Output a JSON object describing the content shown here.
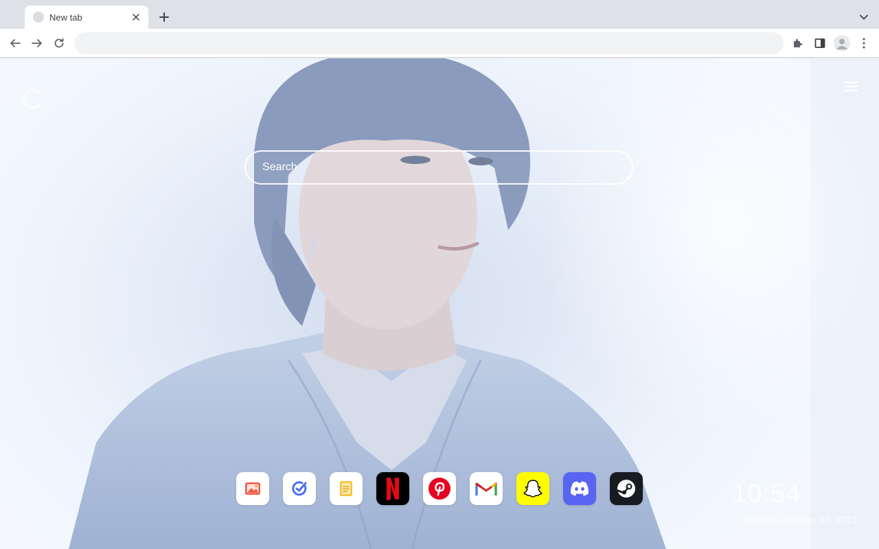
{
  "browser": {
    "tab": {
      "title": "New tab",
      "favicon": "globe-icon"
    },
    "icons": {
      "tab_close": "close-icon",
      "new_tab": "plus-icon",
      "tab_search": "chevron-down-icon",
      "back": "back-arrow-icon",
      "forward": "forward-arrow-icon",
      "reload": "reload-icon",
      "extensions": "puzzle-icon",
      "side_panel": "side-panel-icon",
      "profile": "avatar-icon",
      "menu": "kebab-menu-icon"
    },
    "omnibox": {
      "value": "",
      "placeholder": ""
    }
  },
  "newtab": {
    "search": {
      "placeholder": "Search"
    },
    "menu_icon": "hamburger-icon",
    "logo_icon": "brand-logo-icon",
    "shortcuts": [
      {
        "name": "photos",
        "icon": "photo-icon",
        "bg": "#ffffff"
      },
      {
        "name": "tasks",
        "icon": "check-circle-icon",
        "bg": "#ffffff"
      },
      {
        "name": "notes",
        "icon": "notes-icon",
        "bg": "#ffffff"
      },
      {
        "name": "netflix",
        "icon": "netflix-icon",
        "bg": "#000000"
      },
      {
        "name": "pinterest",
        "icon": "pinterest-icon",
        "bg": "#ffffff"
      },
      {
        "name": "gmail",
        "icon": "gmail-icon",
        "bg": "#ffffff"
      },
      {
        "name": "snapchat",
        "icon": "snapchat-icon",
        "bg": "#fffc00"
      },
      {
        "name": "discord",
        "icon": "discord-icon",
        "bg": "#5865f2"
      },
      {
        "name": "steam",
        "icon": "steam-icon",
        "bg": "#171a21"
      }
    ],
    "clock": {
      "time": "10:54",
      "date": "Tuesday, October 10, 2023"
    }
  },
  "colors": {
    "tabstrip": "#dee1e6",
    "toolbar": "#ffffff",
    "omnibox": "#f1f3f4",
    "wallpaper_tint": "#dfe8f6"
  }
}
